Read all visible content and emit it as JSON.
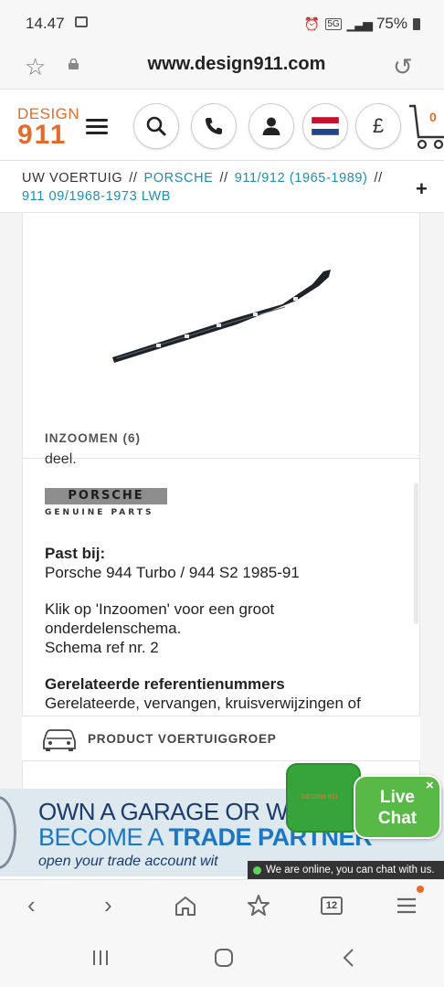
{
  "status_bar": {
    "time": "14.47",
    "network": "5G",
    "battery": "75%"
  },
  "browser": {
    "url": "www.design911.com",
    "tab_count": "12"
  },
  "site": {
    "logo_top": "DESIGN",
    "logo_bottom": "911",
    "cart_count": "0",
    "currency_symbol": "£"
  },
  "breadcrumb": {
    "items": [
      "UW VOERTUIG",
      "PORSCHE",
      "911/912 (1965-1989)",
      "911 09/1968-1973 LWB"
    ],
    "separator": "//",
    "expand": "+"
  },
  "product": {
    "zoom_label": "INZOOMEN (6)",
    "clipped_text": "deel.",
    "brand_logo_text": "PORSCHE",
    "brand_logo_sub": "GENUINE PARTS",
    "fits_heading": "Past bij:",
    "fits_value": "Porsche 944 Turbo / 944 S2 1985-91",
    "zoom_hint": "Klik op 'Inzoomen' voor een groot onderdelenschema.",
    "schema_ref": "Schema ref nr. 2",
    "related_heading": "Gerelateerde referentienummers",
    "related_text": "Gerelateerde, vervangen, kruisverwijzingen of",
    "vehicle_group_label": "PRODUCT VOERTUIGGROEP"
  },
  "banner": {
    "line1": "OWN A GARAGE OR W",
    "line2_a": "BECOME A ",
    "line2_b": "TRADE PARTNER",
    "line3": "open your trade account wit"
  },
  "chat": {
    "logo_text": "DESIGN 911",
    "live_chat_line1": "Live",
    "live_chat_line2": "Chat",
    "close": "×",
    "online_text": "We are online, you can chat with us."
  },
  "colors": {
    "brand_orange": "#e46c2a",
    "link_blue": "#1e8fb0",
    "chat_green": "#58b947"
  }
}
